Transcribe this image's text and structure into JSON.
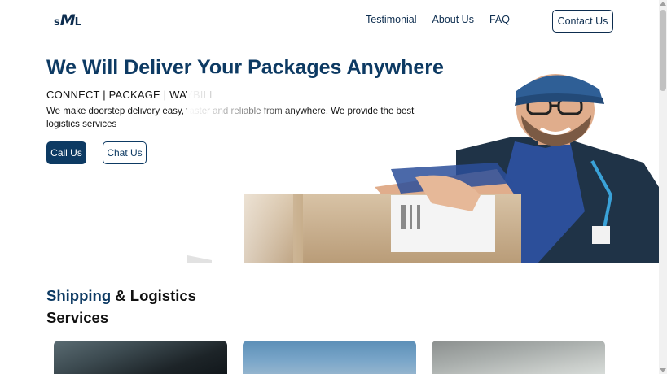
{
  "header": {
    "logo": {
      "s": "s",
      "m": "M",
      "l": "L"
    },
    "nav": [
      {
        "label": "Testimonial"
      },
      {
        "label": "About Us"
      },
      {
        "label": "FAQ"
      }
    ],
    "contact_label": "Contact Us"
  },
  "hero": {
    "title": "We Will Deliver Your Packages Anywhere",
    "tagline": "CONNECT | PACKAGE | WAYBILL",
    "description": "We make doorstep delivery easy, faster and reliable from anywhere. We provide the best logistics services",
    "call_label": "Call Us",
    "chat_label": "Chat Us"
  },
  "services": {
    "title_accent": "Shipping",
    "title_rest": "& Logistics",
    "title_line2": "Services"
  },
  "colors": {
    "brand": "#0d3a63",
    "background": "#ffffff"
  }
}
